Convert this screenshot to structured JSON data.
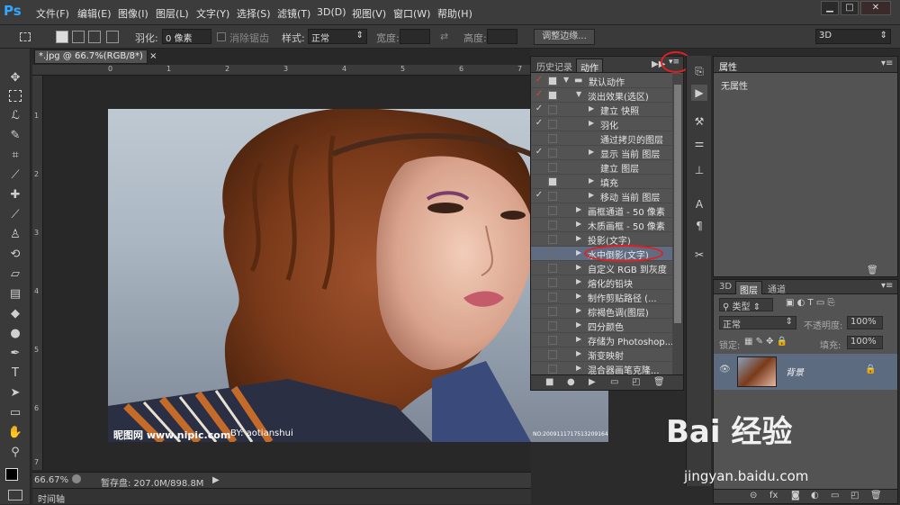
{
  "app": {
    "logo": "Ps"
  },
  "menu": [
    "文件(F)",
    "编辑(E)",
    "图像(I)",
    "图层(L)",
    "文字(Y)",
    "选择(S)",
    "滤镜(T)",
    "3D(D)",
    "视图(V)",
    "窗口(W)",
    "帮助(H)"
  ],
  "window_controls": {
    "minimize": "▁",
    "maximize": "□",
    "close": "✕"
  },
  "options_bar": {
    "feather_label": "羽化:",
    "feather_value": "0 像素",
    "antialias_label": "消除锯齿",
    "style_label": "样式:",
    "style_value": "正常",
    "width_label": "宽度:",
    "height_label": "高度:",
    "refine_button": "调整边缘...",
    "workspace_value": "3D"
  },
  "document": {
    "tab_title": "*.jpg @ 66.7%(RGB/8*)",
    "tab_close": "×",
    "ruler_h": [
      "0",
      "1",
      "2",
      "3",
      "4",
      "5",
      "6",
      "7"
    ],
    "ruler_v": [
      "1",
      "2",
      "3",
      "4",
      "5",
      "6",
      "7"
    ],
    "image_watermark_left": "昵图网 www.nipic.com",
    "image_watermark_by": "BY: aotianshui",
    "image_watermark_id": "NO:20091117175132091643"
  },
  "status_bar": {
    "zoom": "66.67%",
    "scratch": "暂存盘: 207.0M/898.8M"
  },
  "timeline_label": "时间轴",
  "actions_panel": {
    "tab_history": "历史记录",
    "tab_actions": "动作",
    "rows": [
      {
        "check": "✓",
        "level": 0,
        "expanded": true,
        "folder": true,
        "label": "默认动作",
        "check_red": true
      },
      {
        "check": "✓",
        "level": 1,
        "expanded": true,
        "folder": false,
        "label": "淡出效果(选区)",
        "check_red": true
      },
      {
        "check": "✓",
        "level": 2,
        "expanded": false,
        "folder": false,
        "label": "建立 快照"
      },
      {
        "check": "✓",
        "level": 2,
        "expanded": false,
        "folder": false,
        "label": "羽化"
      },
      {
        "check": "",
        "level": 2,
        "expanded": null,
        "folder": false,
        "label": "通过拷贝的图层"
      },
      {
        "check": "✓",
        "level": 2,
        "expanded": false,
        "folder": false,
        "label": "显示 当前 图层"
      },
      {
        "check": "",
        "level": 2,
        "expanded": null,
        "folder": false,
        "label": "建立 图层"
      },
      {
        "check": "",
        "level": 2,
        "expanded": false,
        "folder": false,
        "label": "填充"
      },
      {
        "check": "✓",
        "level": 2,
        "expanded": false,
        "folder": false,
        "label": "移动 当前 图层"
      },
      {
        "check": "",
        "level": 1,
        "expanded": false,
        "folder": false,
        "label": "画框通道 - 50 像素"
      },
      {
        "check": "",
        "level": 1,
        "expanded": false,
        "folder": false,
        "label": "木质画框 - 50 像素"
      },
      {
        "check": "",
        "level": 1,
        "expanded": false,
        "folder": false,
        "label": "投影(文字)"
      },
      {
        "check": "",
        "level": 1,
        "expanded": false,
        "folder": false,
        "label": "水中倒影(文字)",
        "highlight": true
      },
      {
        "check": "",
        "level": 1,
        "expanded": false,
        "folder": false,
        "label": "自定义 RGB 到灰度"
      },
      {
        "check": "",
        "level": 1,
        "expanded": false,
        "folder": false,
        "label": "熔化的铅块"
      },
      {
        "check": "",
        "level": 1,
        "expanded": false,
        "folder": false,
        "label": "制作剪贴路径 (..."
      },
      {
        "check": "",
        "level": 1,
        "expanded": false,
        "folder": false,
        "label": "棕褐色调(图层)"
      },
      {
        "check": "",
        "level": 1,
        "expanded": false,
        "folder": false,
        "label": "四分颜色"
      },
      {
        "check": "",
        "level": 1,
        "expanded": false,
        "folder": false,
        "label": "存储为 Photoshop..."
      },
      {
        "check": "",
        "level": 1,
        "expanded": false,
        "folder": false,
        "label": "渐变映射"
      },
      {
        "check": "",
        "level": 1,
        "expanded": false,
        "folder": false,
        "label": "混合器画笔克隆..."
      }
    ],
    "bottom_icons": [
      "stop-icon",
      "record-icon",
      "play-icon",
      "folder-icon",
      "new-icon",
      "trash-icon"
    ]
  },
  "properties_panel": {
    "title": "属性",
    "content": "无属性"
  },
  "layers_panel": {
    "tab_3d": "3D",
    "tab_layers": "图层",
    "tab_channels": "通道",
    "filter_label": "类型",
    "blend_mode": "正常",
    "opacity_label": "不透明度:",
    "opacity_value": "100%",
    "lock_label": "锁定:",
    "fill_label": "填充:",
    "fill_value": "100%",
    "layer_name": "背景"
  },
  "watermark": {
    "logo": "Bai 经验",
    "url": "jingyan.baidu.com"
  },
  "colors": {
    "highlight_red": "#e02020",
    "selected_row": "#5d6b80",
    "panel": "#535353"
  }
}
